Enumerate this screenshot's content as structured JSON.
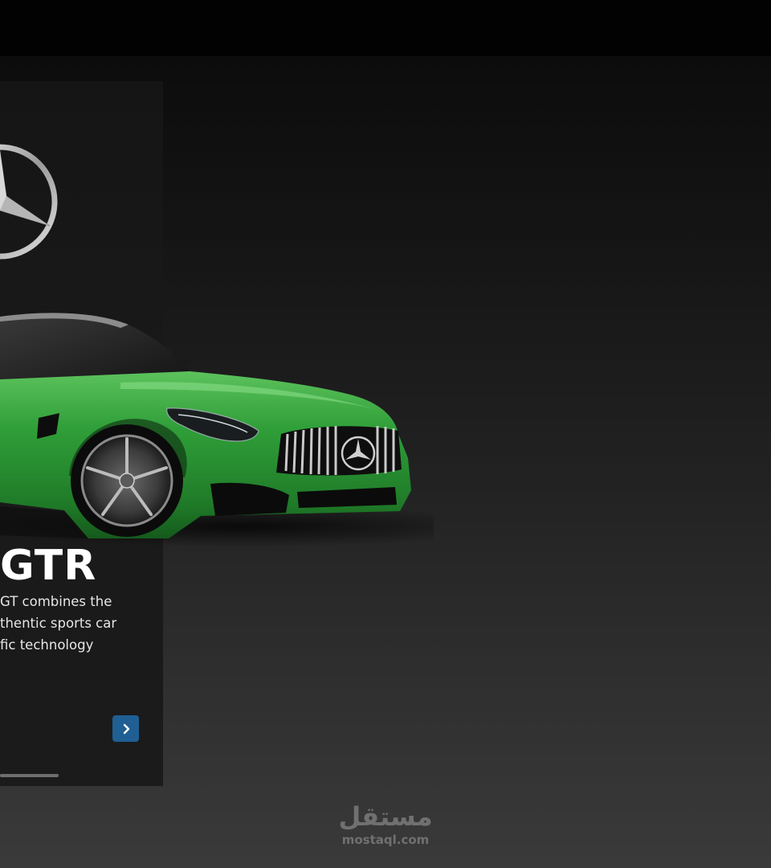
{
  "hero": {
    "model": "GTR",
    "description_lines": [
      " GT combines the",
      "thentic sports car",
      "fic technology"
    ],
    "next_icon": "chevron-right-icon",
    "brand_icon": "mercedes-star-icon"
  },
  "watermark": {
    "arabic": "مستقل",
    "url": "mostaql.com"
  },
  "colors": {
    "car": "#2e9a3a",
    "button": "#1f5f94",
    "card": "#181818"
  }
}
